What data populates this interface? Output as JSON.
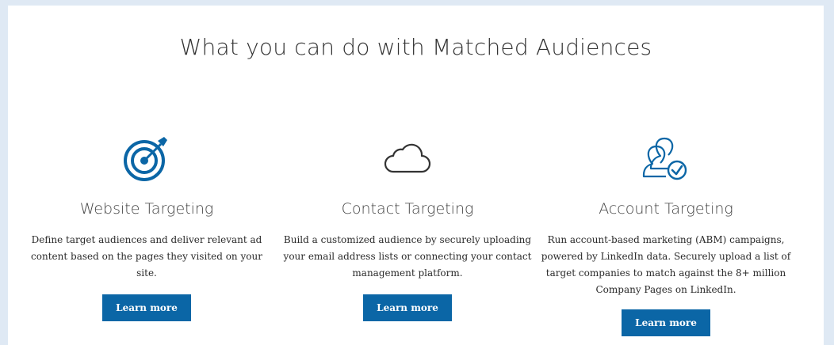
{
  "heading": "What you can do with Matched Audiences",
  "accent_color": "#0b66a6",
  "cards": [
    {
      "icon": "target-icon",
      "title": "Website Targeting",
      "description": "Define target audiences and deliver relevant ad content based on the pages they visited on your site.",
      "button_label": "Learn more"
    },
    {
      "icon": "cloud-icon",
      "title": "Contact Targeting",
      "description": "Build a customized audience by securely uploading your email address lists or connecting your contact management platform.",
      "button_label": "Learn more"
    },
    {
      "icon": "account-people-check-icon",
      "title": "Account Targeting",
      "description": "Run account-based marketing (ABM) campaigns, powered by LinkedIn data. Securely upload a list of target companies to match against the 8+ million Company Pages on LinkedIn.",
      "button_label": "Learn more"
    }
  ]
}
